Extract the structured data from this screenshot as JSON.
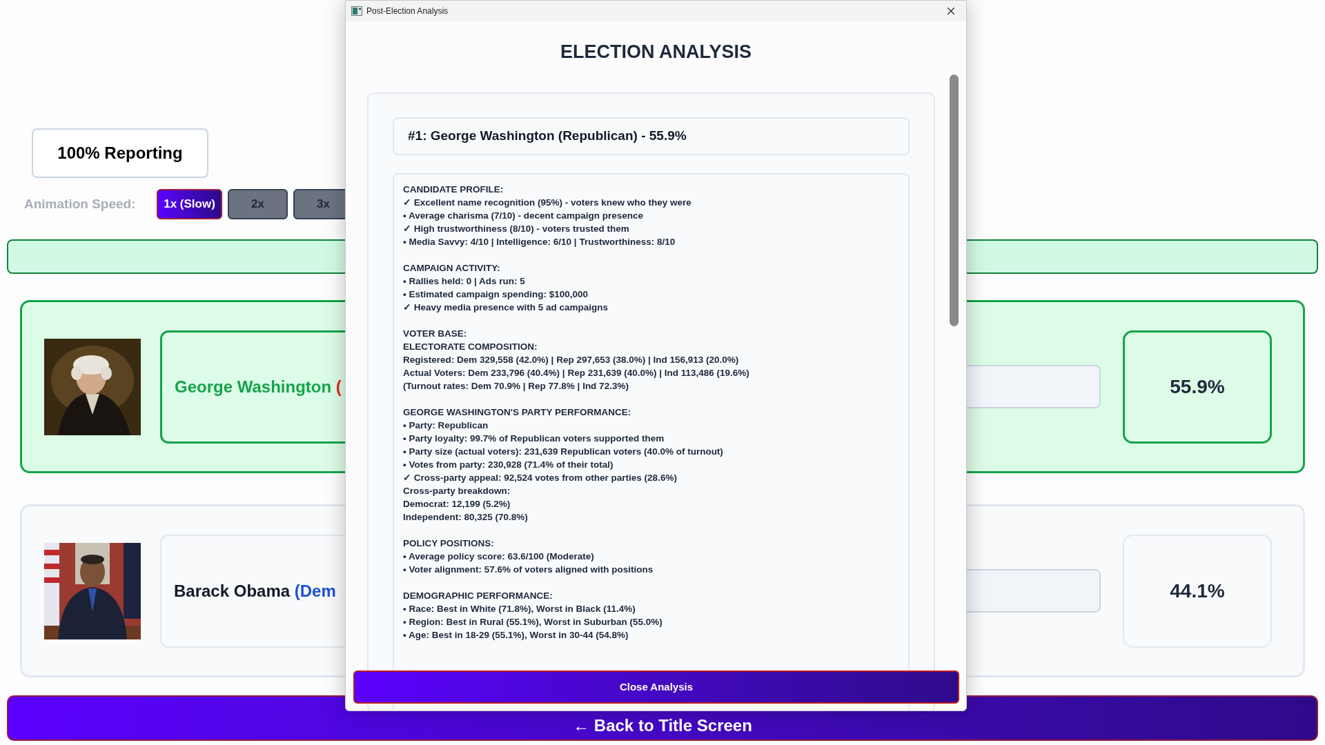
{
  "reporting": "100% Reporting",
  "speed": {
    "label": "Animation Speed:",
    "options": [
      {
        "label": "1x (Slow)",
        "selected": true
      },
      {
        "label": "2x",
        "selected": false
      },
      {
        "label": "3x",
        "selected": false
      }
    ]
  },
  "candidates": [
    {
      "name": "George Washington",
      "party": "(",
      "color": "#dc2626",
      "winner": true,
      "percent": "55.9%"
    },
    {
      "name": "Barack Obama",
      "party": "(Dem",
      "color": "#1d4ed8",
      "winner": false,
      "percent": "44.1%"
    }
  ],
  "back_button": "← Back to Title Screen",
  "dialog": {
    "title": "Post-Election Analysis",
    "heading": "ELECTION ANALYSIS",
    "result": "#1: George Washington (Republican) - 55.9%",
    "sections": [
      {
        "lines": [
          "CANDIDATE PROFILE:",
          "✓ Excellent name recognition (95%) - voters knew who they were",
          "• Average charisma (7/10) - decent campaign presence",
          "✓ High trustworthiness (8/10) - voters trusted them",
          "• Media Savvy: 4/10 | Intelligence: 6/10 | Trustworthiness: 8/10"
        ]
      },
      {
        "lines": [
          "CAMPAIGN ACTIVITY:",
          "• Rallies held: 0 | Ads run: 5",
          "• Estimated campaign spending: $100,000",
          "✓ Heavy media presence with 5 ad campaigns"
        ]
      },
      {
        "lines": [
          "VOTER BASE:",
          "ELECTORATE COMPOSITION:",
          "Registered: Dem 329,558 (42.0%) | Rep 297,653 (38.0%) | Ind 156,913 (20.0%)",
          "Actual Voters: Dem 233,796 (40.4%) | Rep 231,639 (40.0%) | Ind 113,486 (19.6%)",
          "(Turnout rates: Dem 70.9% | Rep 77.8% | Ind 72.3%)"
        ]
      },
      {
        "lines": [
          "GEORGE WASHINGTON'S PARTY PERFORMANCE:",
          "• Party: Republican",
          "• Party loyalty: 99.7% of Republican voters supported them",
          "• Party size (actual voters): 231,639 Republican voters (40.0% of turnout)",
          "• Votes from party: 230,928 (71.4% of their total)",
          "✓ Cross-party appeal: 92,524 votes from other parties (28.6%)",
          "Cross-party breakdown:",
          "Democrat: 12,199 (5.2%)",
          "Independent: 80,325 (70.8%)"
        ]
      },
      {
        "lines": [
          "POLICY POSITIONS:",
          "• Average policy score: 63.6/100 (Moderate)",
          "• Voter alignment: 57.6% of voters aligned with positions"
        ]
      },
      {
        "lines": [
          "DEMOGRAPHIC PERFORMANCE:",
          "• Race: Best in White (71.8%), Worst in Black (11.4%)",
          "• Region: Best in Rural (55.1%), Worst in Suburban (55.0%)",
          "• Age: Best in 18-29 (55.1%), Worst in 30-44 (54.8%)"
        ]
      }
    ],
    "close_button": "Close Analysis"
  }
}
